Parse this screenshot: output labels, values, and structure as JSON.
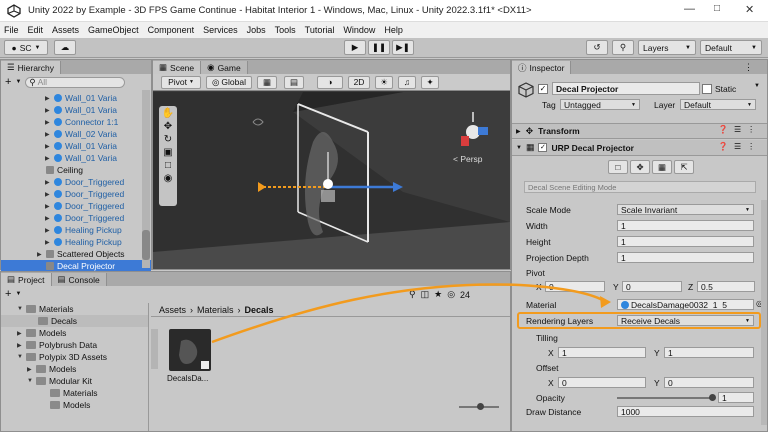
{
  "window": {
    "title": "Unity 2022 by Example - 3D FPS Game Continue - Habitat Interior 1 - Windows, Mac, Linux - Unity 2022.3.1f1* <DX11>"
  },
  "menu": [
    "File",
    "Edit",
    "Assets",
    "GameObject",
    "Component",
    "Services",
    "Jobs",
    "Tools",
    "Tutorial",
    "Window",
    "Help"
  ],
  "toolbar": {
    "account": "SC",
    "layers": "Layers",
    "layout": "Default"
  },
  "hierarchy": {
    "tab": "Hierarchy",
    "search_placeholder": "All",
    "items": [
      {
        "label": "Wall_01 Varia",
        "blue": true
      },
      {
        "label": "Wall_01 Varia",
        "blue": true
      },
      {
        "label": "Connector 1:1",
        "blue": true
      },
      {
        "label": "Wall_02 Varia",
        "blue": true
      },
      {
        "label": "Wall_01 Varia",
        "blue": true
      },
      {
        "label": "Wall_01 Varia",
        "blue": true
      },
      {
        "label": "Ceiling",
        "blue": false
      },
      {
        "label": "Door_Triggered",
        "blue": true
      },
      {
        "label": "Door_Triggered",
        "blue": true
      },
      {
        "label": "Door_Triggered",
        "blue": true
      },
      {
        "label": "Door_Triggered",
        "blue": true
      },
      {
        "label": "Healing Pickup",
        "blue": true
      },
      {
        "label": "Healing Pickup",
        "blue": true
      },
      {
        "label": "Scattered Objects",
        "blue": false
      },
      {
        "label": "Decal Projector",
        "blue": false,
        "selected": true
      }
    ]
  },
  "scene": {
    "tab_scene": "Scene",
    "tab_game": "Game",
    "pivot": "Pivot",
    "global": "Global",
    "mode2d": "2D",
    "persp": "< Persp"
  },
  "project": {
    "tab_project": "Project",
    "tab_console": "Console",
    "count": "24",
    "tree": [
      "Materials",
      "Decals",
      "Models",
      "Polybrush Data",
      "Polypix 3D Assets",
      "Models",
      "Modular Kit",
      "Materials",
      "Models"
    ],
    "breadcrumb": [
      "Assets",
      "Materials",
      "Decals"
    ],
    "asset_label": "DecalsDa..."
  },
  "inspector": {
    "tab": "Inspector",
    "object_name": "Decal Projector",
    "static_label": "Static",
    "tag_label": "Tag",
    "tag_value": "Untagged",
    "layer_label": "Layer",
    "layer_value": "Default",
    "transform": "Transform",
    "component": "URP Decal Projector",
    "editing_mode": "Decal Scene Editing Mode",
    "scale_mode_label": "Scale Mode",
    "scale_mode_value": "Scale Invariant",
    "width_label": "Width",
    "width_value": "1",
    "height_label": "Height",
    "height_value": "1",
    "depth_label": "Projection Depth",
    "depth_value": "1",
    "pivot_label": "Pivot",
    "pivot_x": "0",
    "pivot_y": "0",
    "pivot_z": "0.5",
    "material_label": "Material",
    "material_value": "DecalsDamage0032_1_5",
    "rendering_layers_label": "Rendering Layers",
    "rendering_layers_value": "Receive Decals",
    "tilling_label": "Tilling",
    "tilling_x": "1",
    "tilling_y": "1",
    "offset_label": "Offset",
    "offset_x": "0",
    "offset_y": "0",
    "opacity_label": "Opacity",
    "opacity_value": "1",
    "draw_distance_label": "Draw Distance",
    "draw_distance_value": "1000",
    "x": "X",
    "y": "Y",
    "z": "Z"
  },
  "colors": {
    "highlight": "#f29b1e",
    "selection": "#3d7ad6",
    "link_blue": "#2e86de"
  }
}
